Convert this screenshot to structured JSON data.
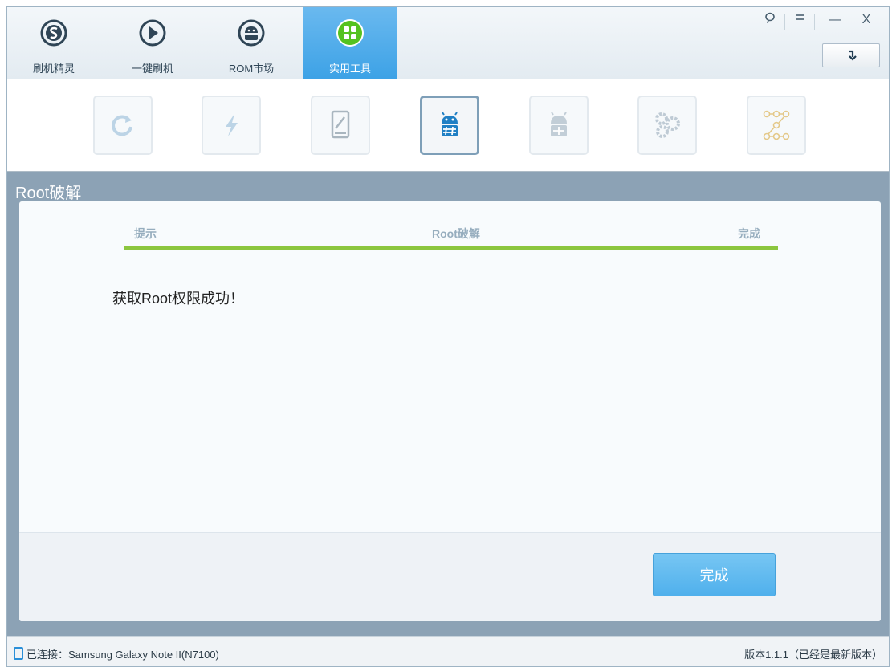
{
  "nav": {
    "tabs": [
      {
        "label": "刷机精灵",
        "icon": "s-logo-icon"
      },
      {
        "label": "一键刷机",
        "icon": "play-icon"
      },
      {
        "label": "ROM市场",
        "icon": "android-icon"
      },
      {
        "label": "实用工具",
        "icon": "grid-icon",
        "active": true
      }
    ]
  },
  "window_controls": {
    "feedback": "feedback-icon",
    "menu": "menu-icon",
    "minimize": "—",
    "close": "X"
  },
  "tools": [
    {
      "icon": "refresh-icon"
    },
    {
      "icon": "flash-icon"
    },
    {
      "icon": "tablet-edit-icon"
    },
    {
      "icon": "root-android-icon",
      "selected": true
    },
    {
      "icon": "android-unroot-icon"
    },
    {
      "icon": "gears-icon"
    },
    {
      "icon": "pattern-lock-icon"
    }
  ],
  "section": {
    "title": "Root破解"
  },
  "steps": [
    "提示",
    "Root破解",
    "完成"
  ],
  "progress": 1.0,
  "message": "获取Root权限成功！",
  "done_button": "完成",
  "status": {
    "connected": "已连接：Samsung Galaxy Note II(N7100)",
    "version": "版本1.1.1（已经是最新版本）"
  },
  "colors": {
    "accent": "#3da2e6",
    "progress": "#8cc63f",
    "section_bg": "#8ca2b5"
  }
}
